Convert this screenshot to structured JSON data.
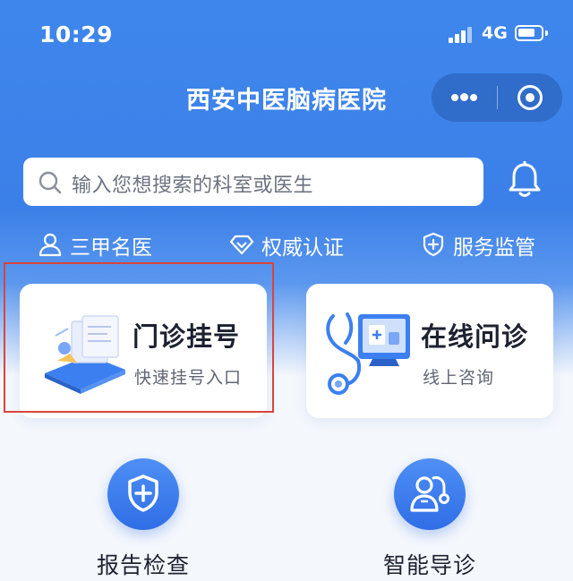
{
  "status_bar": {
    "time": "10:29",
    "network": "4G"
  },
  "nav": {
    "title": "西安中医脑病医院"
  },
  "search": {
    "placeholder": "输入您想搜索的科室或医生"
  },
  "features": [
    {
      "label": "三甲名医",
      "icon": "doctor-icon"
    },
    {
      "label": "权威认证",
      "icon": "diamond-icon"
    },
    {
      "label": "服务监管",
      "icon": "shield-plus-icon"
    }
  ],
  "cards": [
    {
      "title": "门诊挂号",
      "subtitle": "快速挂号入口",
      "icon": "registration-illustration"
    },
    {
      "title": "在线问诊",
      "subtitle": "线上咨询",
      "icon": "stethoscope-monitor-illustration"
    }
  ],
  "quick_actions": [
    {
      "label": "报告检查",
      "icon": "shield-plus-icon"
    },
    {
      "label": "智能导诊",
      "icon": "doctor-stethoscope-icon"
    }
  ],
  "colors": {
    "primary": "#3b80e8",
    "accent_red": "#d9443d",
    "text_dark": "#1d2230"
  }
}
